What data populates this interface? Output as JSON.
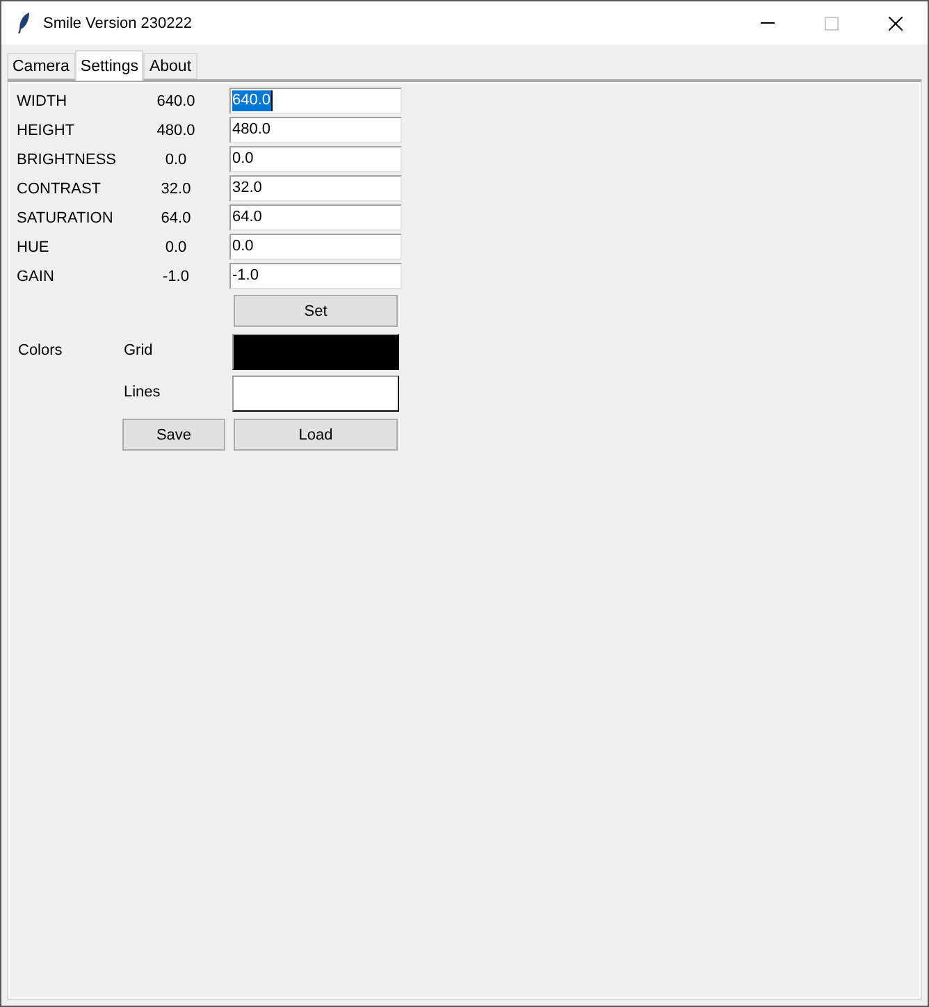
{
  "window": {
    "title": "Smile Version 230222",
    "maximize_enabled": false
  },
  "tabs": [
    {
      "label": "Camera",
      "selected": false
    },
    {
      "label": "Settings",
      "selected": true
    },
    {
      "label": "About",
      "selected": false
    }
  ],
  "settings": [
    {
      "name": "WIDTH",
      "current": "640.0",
      "value": "640.0",
      "text_selected": true
    },
    {
      "name": "HEIGHT",
      "current": "480.0",
      "value": "480.0",
      "text_selected": false
    },
    {
      "name": "BRIGHTNESS",
      "current": "0.0",
      "value": "0.0",
      "text_selected": false
    },
    {
      "name": "CONTRAST",
      "current": "32.0",
      "value": "32.0",
      "text_selected": false
    },
    {
      "name": "SATURATION",
      "current": "64.0",
      "value": "64.0",
      "text_selected": false
    },
    {
      "name": "HUE",
      "current": "0.0",
      "value": "0.0",
      "text_selected": false
    },
    {
      "name": "GAIN",
      "current": "-1.0",
      "value": "-1.0",
      "text_selected": false
    }
  ],
  "set_button": "Set",
  "colors": {
    "label": "Colors",
    "items": [
      {
        "label": "Grid",
        "color": "#000000"
      },
      {
        "label": "Lines",
        "color": "#ffffff"
      }
    ]
  },
  "buttons": [
    "Save",
    "Load"
  ]
}
